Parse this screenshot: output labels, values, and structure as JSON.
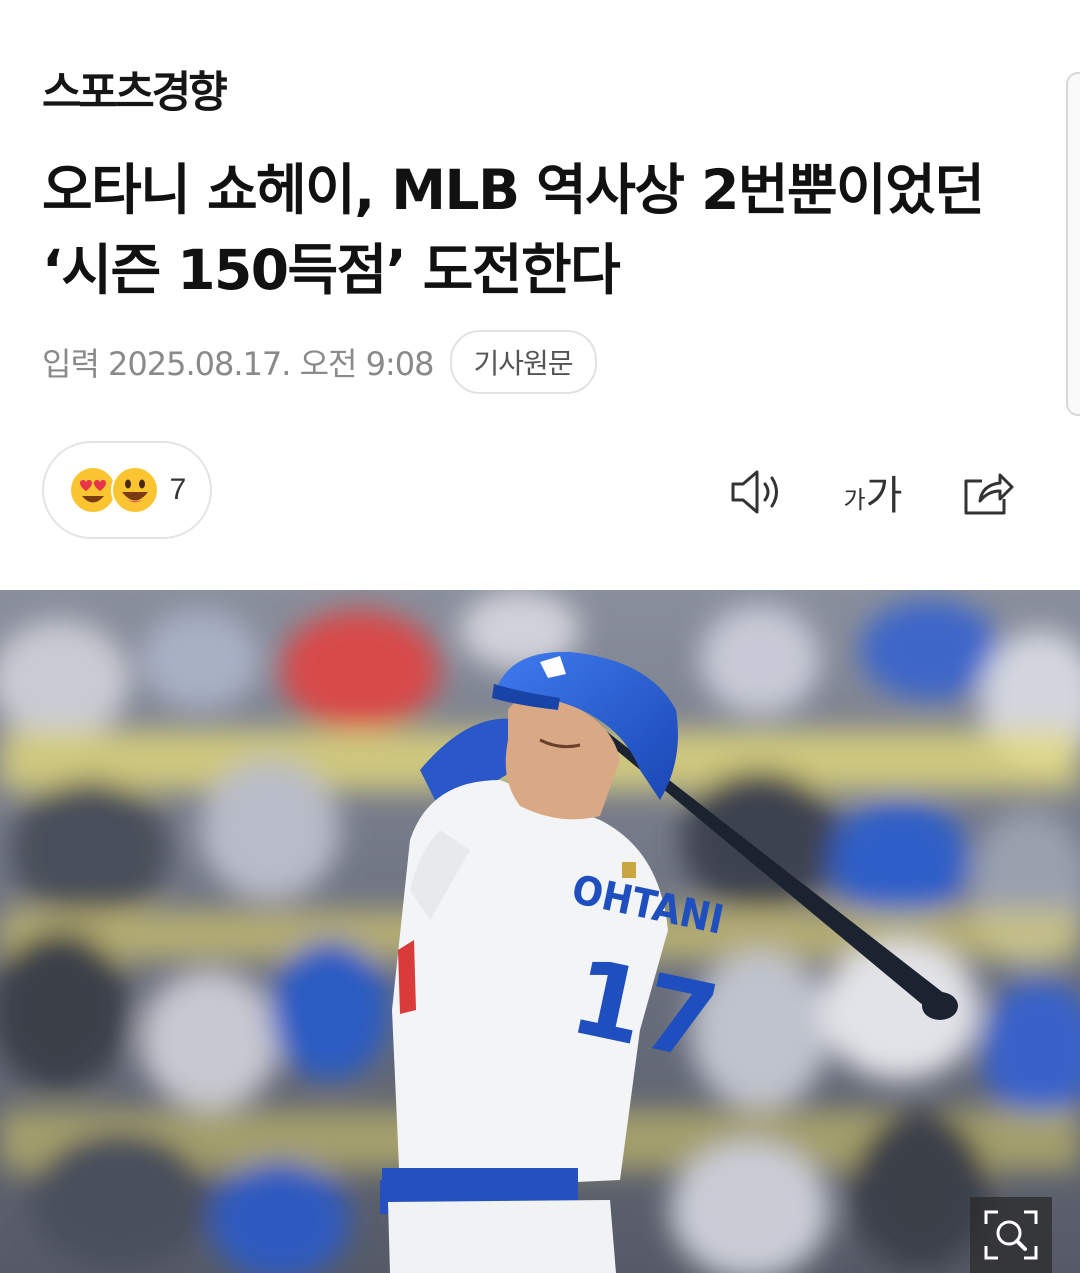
{
  "header": {
    "logo_text": "스포츠경향"
  },
  "article": {
    "headline": "오타니 쇼헤이, MLB 역사상 2번뿐이었던 ‘시즌 150득점’ 도전한다",
    "published": "입력 2025.08.17. 오전 9:08",
    "source_button_label": "기사원문"
  },
  "reactions": {
    "icons": [
      "heart-eyes-emoji-icon",
      "grinning-emoji-icon"
    ],
    "count": "7"
  },
  "toolbar": {
    "speaker_icon": "speaker-icon",
    "font_size_small": "가",
    "font_size_large": "가",
    "share_icon": "share-icon"
  },
  "photo": {
    "jersey_name": "OHTANI",
    "jersey_number": "17",
    "zoom_icon": "zoom-magnifier-icon"
  },
  "colors": {
    "headline": "#111111",
    "meta_text": "#8a8a8a",
    "border": "#e2e2e2",
    "dodger_blue": "#1f4fbf"
  }
}
